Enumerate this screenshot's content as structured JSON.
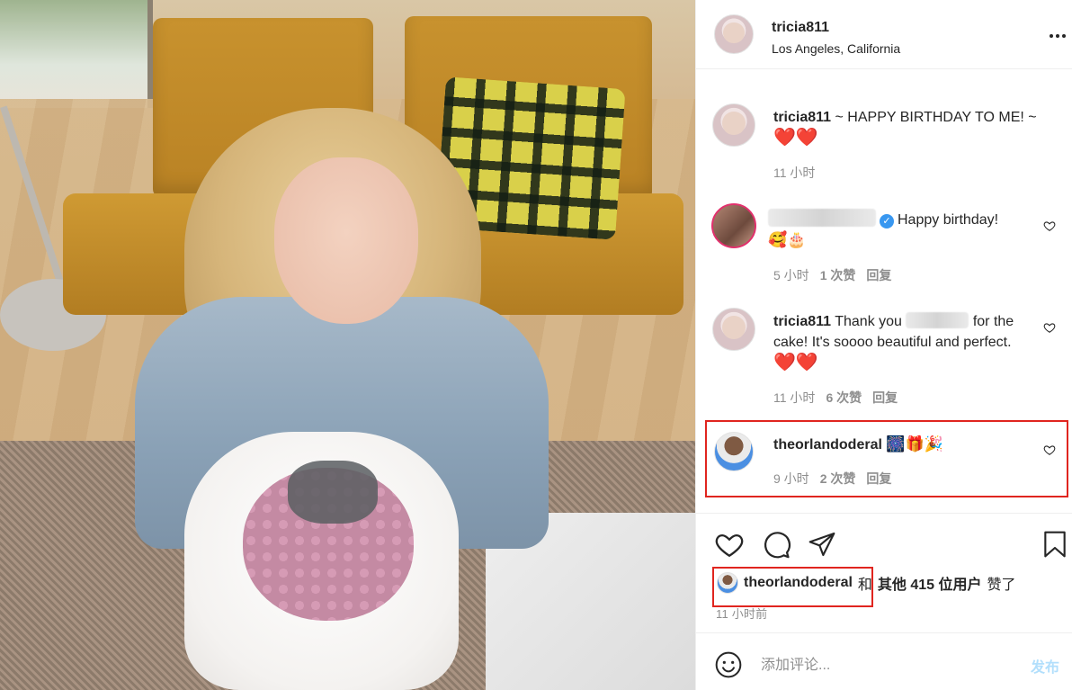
{
  "post_header": {
    "username": "tricia811",
    "location": "Los Angeles, California"
  },
  "caption": {
    "username": "tricia811",
    "text": " ~ HAPPY BIRTHDAY TO ME! ~",
    "emoji": "❤️❤️",
    "time": "11 小时"
  },
  "comments": [
    {
      "text": "Happy birthday!",
      "emoji": "🥰🎂",
      "time": "5 小时",
      "likes": "1 次赞",
      "reply": "回复"
    },
    {
      "username": "tricia811",
      "text_before": " Thank you ",
      "text_after": " for the cake! It's soooo beautiful and perfect.",
      "emoji": "❤️❤️",
      "time": "11 小时",
      "likes": "6 次赞",
      "reply": "回复"
    },
    {
      "username": "theorlandoderal",
      "emoji": "🎆🎁🎉",
      "time": "9 小时",
      "likes": "2 次赞",
      "reply": "回复"
    }
  ],
  "likes_summary": {
    "username": "theorlandoderal",
    "conjunction": "和",
    "others": "其他 415 位用户",
    "suffix": "赞了"
  },
  "post_time": "11 小时前",
  "comment_box": {
    "placeholder": "添加评论...",
    "post_label": "发布"
  },
  "icons": {
    "like": "heart-icon",
    "comment": "comment-bubble-icon",
    "share": "paper-plane-icon",
    "save": "bookmark-icon",
    "emoji": "smiley-icon",
    "more": "more-options-icon"
  },
  "colors": {
    "highlight_box": "#e0251f",
    "verified_badge": "#3897f0",
    "meta_text": "#8e8e8e",
    "post_button": "#b2dffc"
  }
}
